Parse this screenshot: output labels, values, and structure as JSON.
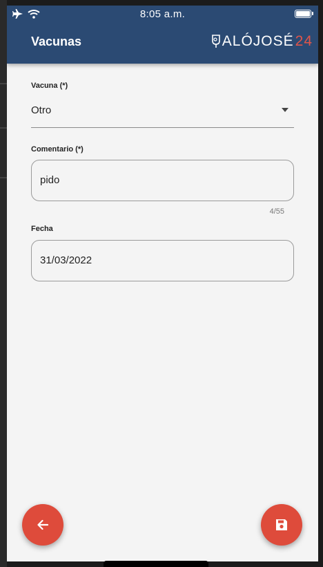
{
  "status_bar": {
    "time": "8:05 a.m."
  },
  "header": {
    "title": "Vacunas",
    "logo_text": "ALÓJOSÉ",
    "logo_number": "24"
  },
  "form": {
    "vacuna": {
      "label": "Vacuna (*)",
      "value": "Otro"
    },
    "comentario": {
      "label": "Comentario (*)",
      "value": "pido",
      "counter": "4/55"
    },
    "fecha": {
      "label": "Fecha",
      "value": "31/03/2022"
    }
  },
  "actions": {
    "back_icon": "arrow-left-icon",
    "save_icon": "save-icon"
  },
  "colors": {
    "app_bar": "#2b4a73",
    "fab": "#de4b3b",
    "background": "#f4f4f4",
    "logo_accent": "#e0554a"
  }
}
